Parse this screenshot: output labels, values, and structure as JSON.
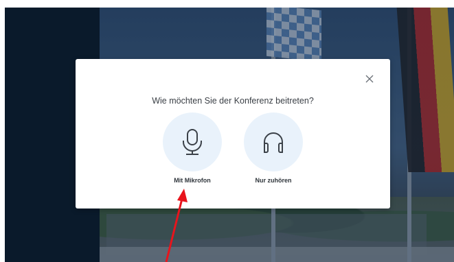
{
  "dialog": {
    "title": "Wie möchten Sie der Konferenz beitreten?",
    "close_icon": "close-icon",
    "options": [
      {
        "label": "Mit Mikrofon",
        "icon": "microphone-icon"
      },
      {
        "label": "Nur zuhören",
        "icon": "headphones-icon"
      }
    ]
  },
  "colors": {
    "dialog_bg": "#ffffff",
    "option_circle_bg": "#e9f2fb",
    "icon_stroke": "#3b4148",
    "sidebar": "#0a1a2b",
    "annotation_arrow": "#e8141c"
  }
}
